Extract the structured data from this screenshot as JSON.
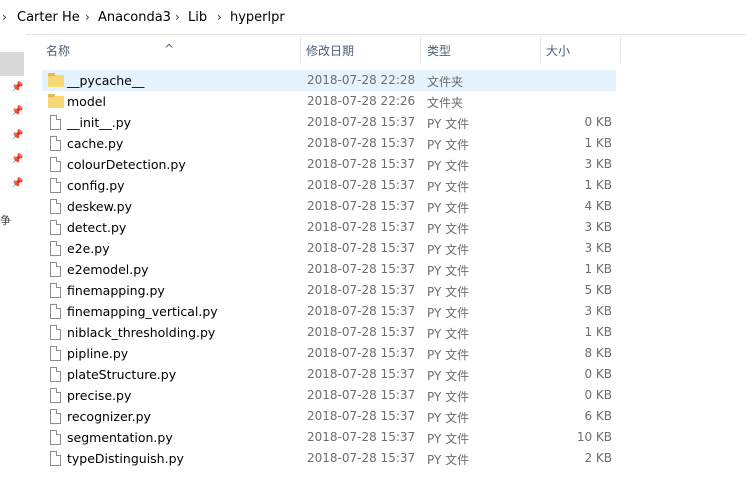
{
  "breadcrumb": {
    "items": [
      "Carter He",
      "Anaconda3",
      "Lib",
      "hyperlpr"
    ]
  },
  "columns": {
    "name": "名称",
    "date": "修改日期",
    "type": "类型",
    "size": "大小"
  },
  "nav": {
    "partial_label": "争"
  },
  "files": [
    {
      "name": "__pycache__",
      "date": "2018-07-28 22:28",
      "type": "文件夹",
      "size": "",
      "kind": "folder",
      "selected": true
    },
    {
      "name": "model",
      "date": "2018-07-28 22:26",
      "type": "文件夹",
      "size": "",
      "kind": "folder"
    },
    {
      "name": "__init__.py",
      "date": "2018-07-28 15:37",
      "type": "PY 文件",
      "size": "0 KB",
      "kind": "file"
    },
    {
      "name": "cache.py",
      "date": "2018-07-28 15:37",
      "type": "PY 文件",
      "size": "1 KB",
      "kind": "file"
    },
    {
      "name": "colourDetection.py",
      "date": "2018-07-28 15:37",
      "type": "PY 文件",
      "size": "3 KB",
      "kind": "file"
    },
    {
      "name": "config.py",
      "date": "2018-07-28 15:37",
      "type": "PY 文件",
      "size": "1 KB",
      "kind": "file"
    },
    {
      "name": "deskew.py",
      "date": "2018-07-28 15:37",
      "type": "PY 文件",
      "size": "4 KB",
      "kind": "file"
    },
    {
      "name": "detect.py",
      "date": "2018-07-28 15:37",
      "type": "PY 文件",
      "size": "3 KB",
      "kind": "file"
    },
    {
      "name": "e2e.py",
      "date": "2018-07-28 15:37",
      "type": "PY 文件",
      "size": "3 KB",
      "kind": "file"
    },
    {
      "name": "e2emodel.py",
      "date": "2018-07-28 15:37",
      "type": "PY 文件",
      "size": "1 KB",
      "kind": "file"
    },
    {
      "name": "finemapping.py",
      "date": "2018-07-28 15:37",
      "type": "PY 文件",
      "size": "5 KB",
      "kind": "file"
    },
    {
      "name": "finemapping_vertical.py",
      "date": "2018-07-28 15:37",
      "type": "PY 文件",
      "size": "3 KB",
      "kind": "file"
    },
    {
      "name": "niblack_thresholding.py",
      "date": "2018-07-28 15:37",
      "type": "PY 文件",
      "size": "1 KB",
      "kind": "file"
    },
    {
      "name": "pipline.py",
      "date": "2018-07-28 15:37",
      "type": "PY 文件",
      "size": "8 KB",
      "kind": "file"
    },
    {
      "name": "plateStructure.py",
      "date": "2018-07-28 15:37",
      "type": "PY 文件",
      "size": "0 KB",
      "kind": "file"
    },
    {
      "name": "precise.py",
      "date": "2018-07-28 15:37",
      "type": "PY 文件",
      "size": "0 KB",
      "kind": "file"
    },
    {
      "name": "recognizer.py",
      "date": "2018-07-28 15:37",
      "type": "PY 文件",
      "size": "6 KB",
      "kind": "file"
    },
    {
      "name": "segmentation.py",
      "date": "2018-07-28 15:37",
      "type": "PY 文件",
      "size": "10 KB",
      "kind": "file"
    },
    {
      "name": "typeDistinguish.py",
      "date": "2018-07-28 15:37",
      "type": "PY 文件",
      "size": "2 KB",
      "kind": "file"
    }
  ],
  "colors": {
    "selected_row": "#e5f3ff",
    "header_text": "#4c607a",
    "folder": "#f8d775"
  }
}
